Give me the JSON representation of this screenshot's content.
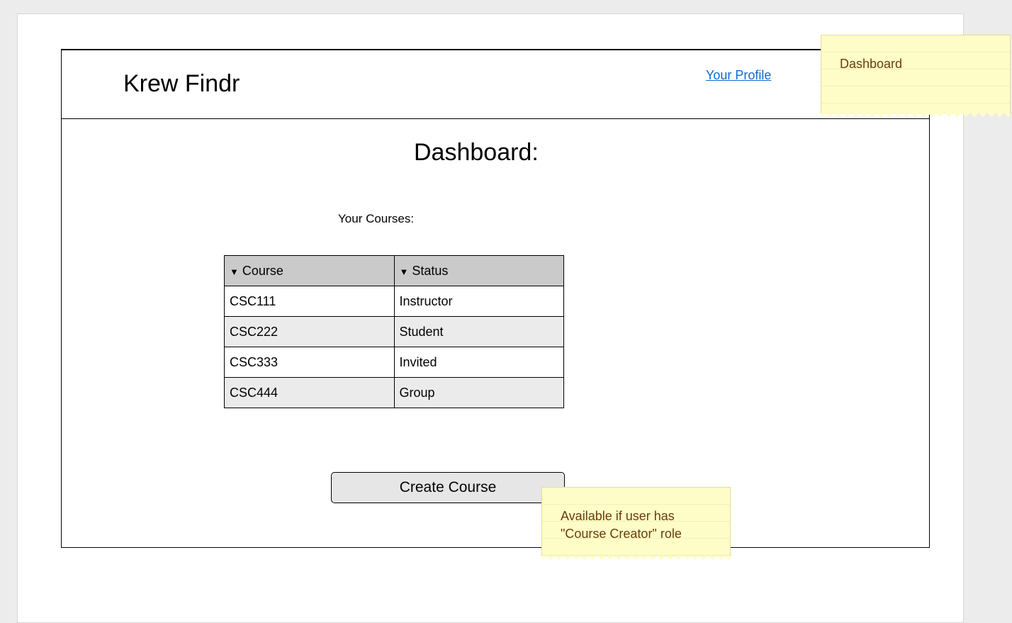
{
  "header": {
    "app_title": "Krew Findr",
    "profile_link": "Your Profile"
  },
  "main": {
    "page_title": "Dashboard:",
    "courses_label": "Your Courses:",
    "table": {
      "columns": [
        "Course",
        "Status"
      ],
      "sort_indicator": "▼",
      "rows": [
        {
          "course": "CSC111",
          "status": "Instructor"
        },
        {
          "course": "CSC222",
          "status": "Student"
        },
        {
          "course": "CSC333",
          "status": "Invited"
        },
        {
          "course": "CSC444",
          "status": "Group"
        }
      ]
    },
    "create_course_button": "Create Course"
  },
  "annotations": {
    "page_note": "Dashboard",
    "create_course_note": "Available if user has\n\"Course Creator\" role"
  },
  "colors": {
    "link": "#0b6ccf",
    "table_header": "#cacaca",
    "row_alt": "#ebebeb",
    "button": "#e6e6e6",
    "sticky_note": "#fefdc8",
    "sticky_text": "#6a3d09"
  },
  "icons": {
    "sort": "sort-down-icon"
  }
}
